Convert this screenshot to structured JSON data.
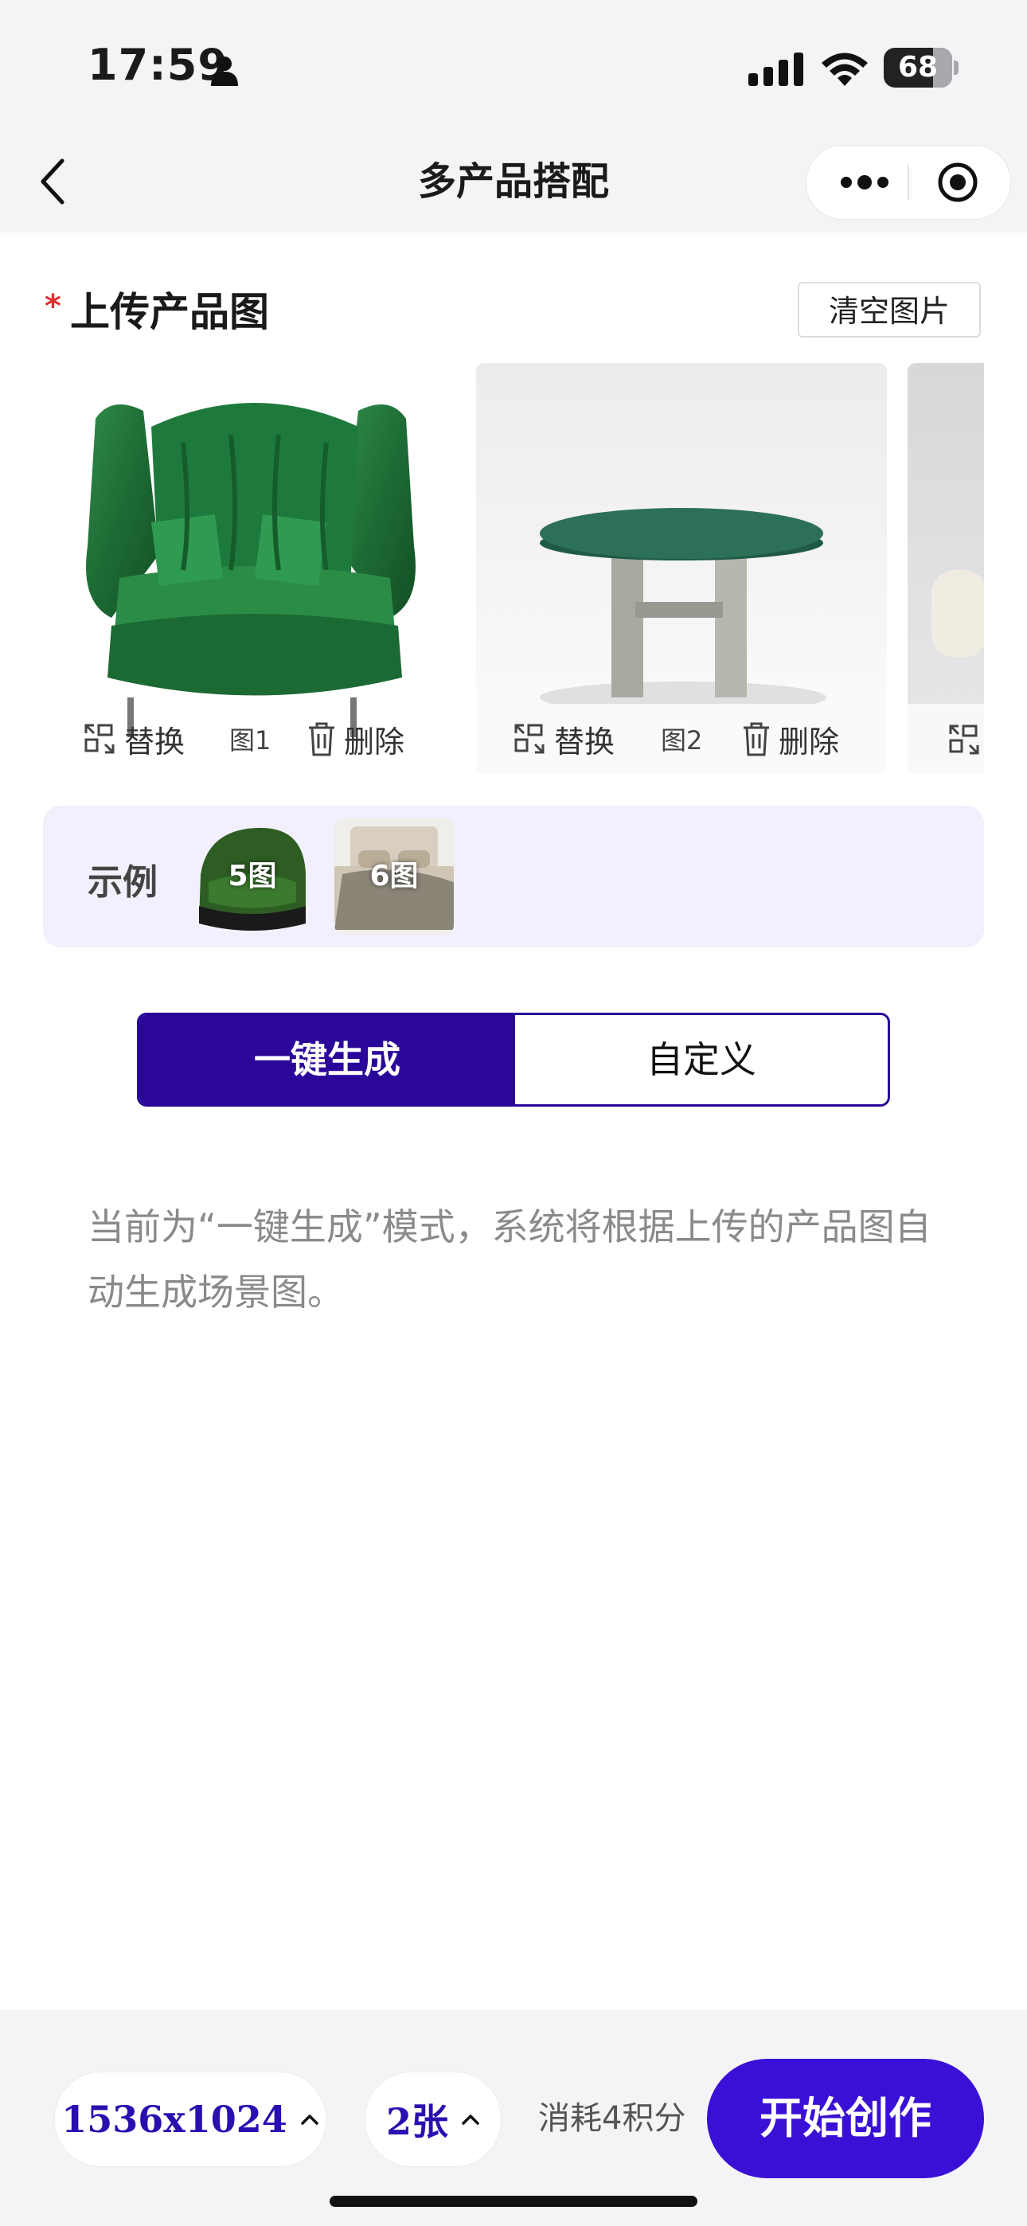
{
  "status_bar": {
    "time": "17:59",
    "battery": "68"
  },
  "nav": {
    "title": "多产品搭配"
  },
  "upload": {
    "required_mark": "*",
    "title": "上传产品图",
    "clear_label": "清空图片",
    "cards": [
      {
        "replace_label": "替换",
        "image_no": "图1",
        "delete_label": "删除",
        "product": "green velvet armchair"
      },
      {
        "replace_label": "替换",
        "image_no": "图2",
        "delete_label": "删除",
        "product": "green marble round table"
      },
      {
        "product": "white sofa (partially visible)"
      }
    ]
  },
  "examples": {
    "label": "示例",
    "items": [
      {
        "caption": "5图",
        "subject": "green leather chair"
      },
      {
        "caption": "6图",
        "subject": "beige bed"
      }
    ]
  },
  "mode": {
    "options": [
      "一键生成",
      "自定义"
    ],
    "selected": "一键生成"
  },
  "description": "当前为“一键生成”模式，系统将根据上传的产品图自动生成场景图。",
  "bottom_bar": {
    "size_value": "1536x1024",
    "count_value": "2张",
    "cost_text": "消耗4积分",
    "start_label": "开始创作"
  },
  "colors": {
    "accent": "#2a0699",
    "button": "#3a0fd6",
    "required": "#e02e2e",
    "examples_bg": "#f3f0fd"
  }
}
